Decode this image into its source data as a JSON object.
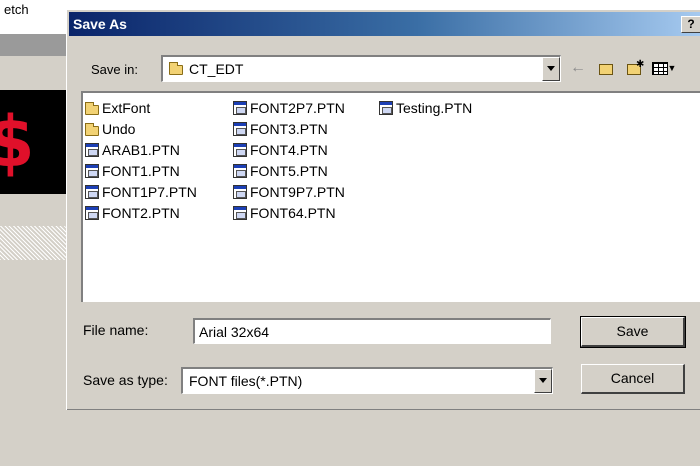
{
  "background_app": {
    "menu_fragment": "etch",
    "led_text": "$"
  },
  "dialog": {
    "title": "Save As",
    "help_label": "?",
    "close_label": "✕",
    "save_in_label": "Save in:",
    "save_in_value": "CT_EDT",
    "toolbar_icons": [
      "back-icon",
      "up-one-level-icon",
      "new-folder-icon",
      "view-menu-icon"
    ],
    "file_columns": [
      [
        {
          "name": "ExtFont",
          "type": "folder"
        },
        {
          "name": "Undo",
          "type": "folder"
        },
        {
          "name": "ARAB1.PTN",
          "type": "file"
        },
        {
          "name": "FONT1.PTN",
          "type": "file"
        },
        {
          "name": "FONT1P7.PTN",
          "type": "file"
        },
        {
          "name": "FONT2.PTN",
          "type": "file"
        }
      ],
      [
        {
          "name": "FONT2P7.PTN",
          "type": "file"
        },
        {
          "name": "FONT3.PTN",
          "type": "file"
        },
        {
          "name": "FONT4.PTN",
          "type": "file"
        },
        {
          "name": "FONT5.PTN",
          "type": "file"
        },
        {
          "name": "FONT9P7.PTN",
          "type": "file"
        },
        {
          "name": "FONT64.PTN",
          "type": "file"
        }
      ],
      [
        {
          "name": "Testing.PTN",
          "type": "file"
        }
      ]
    ],
    "file_name_label": "File name:",
    "file_name_value": "Arial 32x64",
    "save_as_type_label": "Save as type:",
    "save_as_type_value": "FONT files(*.PTN)",
    "save_button": "Save",
    "cancel_button": "Cancel"
  }
}
